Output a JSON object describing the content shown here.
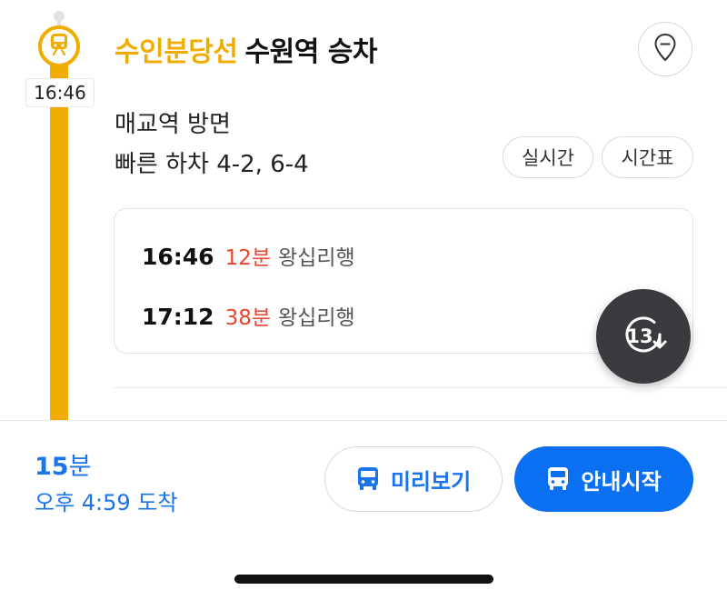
{
  "timeline": {
    "departure_time": "16:46",
    "line_color": "#f0ad00",
    "icon": "train-icon"
  },
  "header": {
    "line_name": "수인분당선",
    "station_action": "수원역 승차",
    "pin_icon": "location-pin-icon"
  },
  "info": {
    "direction": "매교역 방면",
    "fast_exit": "빠른 하차 4-2, 6-4",
    "realtime_label": "실시간",
    "timetable_label": "시간표"
  },
  "arrivals": [
    {
      "time": "16:46",
      "minutes": "12분",
      "destination": "왕십리행"
    },
    {
      "time": "17:12",
      "minutes": "38분",
      "destination": "왕십리행"
    }
  ],
  "refresh": {
    "countdown": "13",
    "icon": "refresh-icon"
  },
  "summary": {
    "duration_value": "15",
    "duration_unit": "분",
    "arrival": "오후 4:59 도착"
  },
  "actions": {
    "preview_label": "미리보기",
    "start_label": "안내시작",
    "icon": "bus-icon"
  },
  "colors": {
    "accent_blue": "#1a73e8",
    "primary_button": "#0b6ff2",
    "minutes_red": "#e9452f"
  }
}
